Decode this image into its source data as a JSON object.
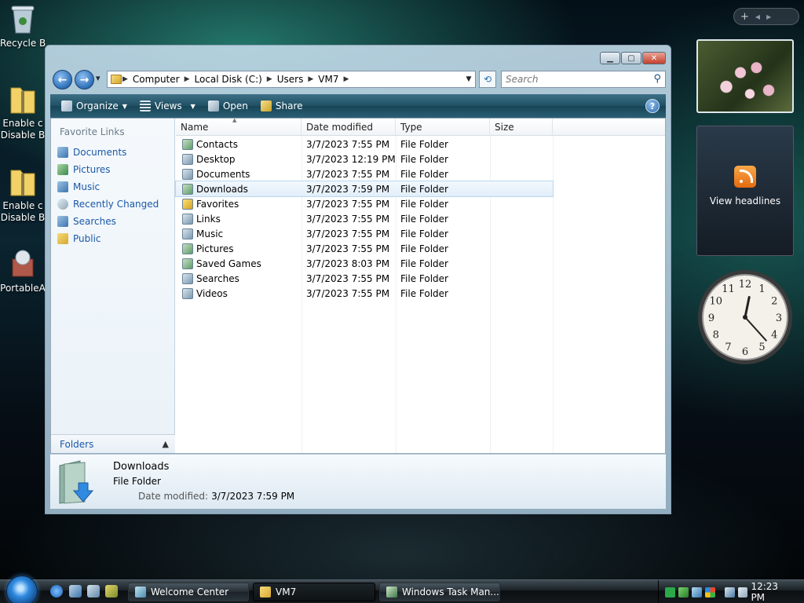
{
  "desktop": {
    "icons": [
      {
        "label": "Recycle B",
        "icon": "recycle-bin-icon"
      },
      {
        "label": "Enable c\nDisable B",
        "icon": "zip-folder-icon"
      },
      {
        "label": "Enable c\nDisable B",
        "icon": "zip-folder-icon"
      },
      {
        "label": "PortableA",
        "icon": "installer-icon"
      }
    ]
  },
  "sidebar": {
    "add_symbol": "+",
    "prev_symbol": "◀",
    "next_symbol": "▶",
    "feed_label": "View headlines",
    "clock": {
      "hour": 12,
      "minute": 23
    }
  },
  "window": {
    "caption": {
      "minimize": "▁",
      "maximize": "▢",
      "close": "✕"
    },
    "nav": {
      "back_symbol": "←",
      "forward_symbol": "→",
      "history_symbol": "▾"
    },
    "breadcrumb": [
      "Computer",
      "Local Disk (C:)",
      "Users",
      "VM7"
    ],
    "search": {
      "placeholder": "Search",
      "icon": "search-icon"
    },
    "toolbar": {
      "organize": "Organize",
      "views": "Views",
      "open": "Open",
      "share": "Share",
      "help": "?"
    },
    "nav_pane": {
      "heading": "Favorite Links",
      "items": [
        "Documents",
        "Pictures",
        "Music",
        "Recently Changed",
        "Searches",
        "Public"
      ],
      "folders_label": "Folders"
    },
    "columns": {
      "name": "Name",
      "date": "Date modified",
      "type": "Type",
      "size": "Size"
    },
    "files": [
      {
        "name": "Contacts",
        "date": "3/7/2023 7:55 PM",
        "type": "File Folder"
      },
      {
        "name": "Desktop",
        "date": "3/7/2023 12:19 PM",
        "type": "File Folder"
      },
      {
        "name": "Documents",
        "date": "3/7/2023 7:55 PM",
        "type": "File Folder"
      },
      {
        "name": "Downloads",
        "date": "3/7/2023 7:59 PM",
        "type": "File Folder"
      },
      {
        "name": "Favorites",
        "date": "3/7/2023 7:55 PM",
        "type": "File Folder"
      },
      {
        "name": "Links",
        "date": "3/7/2023 7:55 PM",
        "type": "File Folder"
      },
      {
        "name": "Music",
        "date": "3/7/2023 7:55 PM",
        "type": "File Folder"
      },
      {
        "name": "Pictures",
        "date": "3/7/2023 7:55 PM",
        "type": "File Folder"
      },
      {
        "name": "Saved Games",
        "date": "3/7/2023 8:03 PM",
        "type": "File Folder"
      },
      {
        "name": "Searches",
        "date": "3/7/2023 7:55 PM",
        "type": "File Folder"
      },
      {
        "name": "Videos",
        "date": "3/7/2023 7:55 PM",
        "type": "File Folder"
      }
    ],
    "selected_index": 3,
    "details": {
      "name": "Downloads",
      "type": "File Folder",
      "date_label": "Date modified:",
      "date_value": "3/7/2023 7:59 PM"
    }
  },
  "taskbar": {
    "buttons": [
      "Welcome Center",
      "VM7",
      "Windows Task Man..."
    ],
    "active_index": 1,
    "clock": "12:23 PM"
  },
  "colors": {
    "accent": "#2d6fb8",
    "link": "#1a58a8",
    "toolbar": "#205064"
  }
}
